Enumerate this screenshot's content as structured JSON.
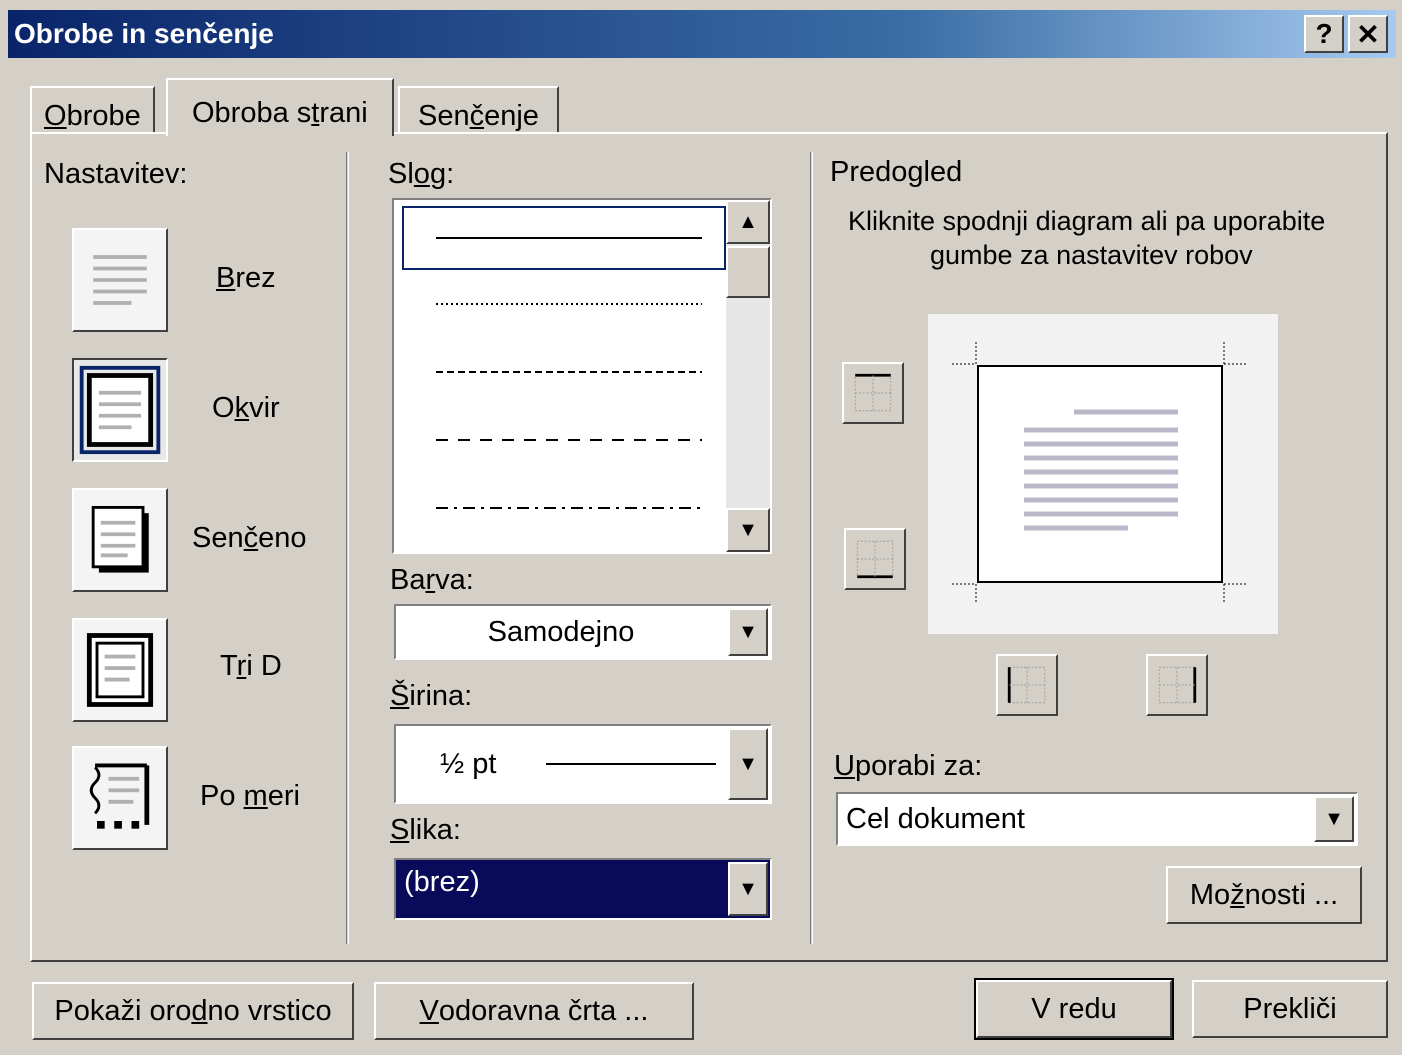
{
  "window": {
    "title": "Obrobe in senčenje",
    "help_label": "?",
    "close_label": "✕"
  },
  "tabs": [
    {
      "label": "Obrobe",
      "accel": "O",
      "rest": "brobe"
    },
    {
      "label": "Obroba strani",
      "pre": "Obroba s",
      "accel": "t",
      "rest": "rani"
    },
    {
      "label": "Senčenje",
      "pre": "Sen",
      "accel": "č",
      "rest": "enje"
    }
  ],
  "settings": {
    "heading": "Nastavitev:",
    "items": [
      {
        "label": "Brez",
        "pre": "",
        "accel": "B",
        "rest": "rez",
        "icon": "none-setting-icon"
      },
      {
        "label": "Okvir",
        "pre": "O",
        "accel": "k",
        "rest": "vir",
        "icon": "box-setting-icon"
      },
      {
        "label": "Senčeno",
        "pre": "Sen",
        "accel": "č",
        "rest": "eno",
        "icon": "shadow-setting-icon"
      },
      {
        "label": "Tri D",
        "pre": "T",
        "accel": "r",
        "rest": "i D",
        "icon": "three-d-setting-icon"
      },
      {
        "label": "Po meri",
        "pre": "Po ",
        "accel": "m",
        "rest": "eri",
        "icon": "custom-setting-icon"
      }
    ]
  },
  "style": {
    "heading": "Slog:",
    "pre": "Sl",
    "accel": "o",
    "rest": "g:",
    "selected_index": 0,
    "items": [
      "solid",
      "dotted",
      "dashed-small",
      "dashed-large",
      "dash-dot"
    ]
  },
  "color": {
    "heading": "Barva:",
    "pre": "Ba",
    "accel": "r",
    "rest": "va:",
    "value": "Samodejno"
  },
  "width": {
    "heading": "Širina:",
    "pre": "",
    "accel": "Š",
    "rest": "irina:",
    "value": "½ pt"
  },
  "art": {
    "heading": "Slika:",
    "pre": "",
    "accel": "S",
    "rest": "lika:",
    "value": "(brez)"
  },
  "preview": {
    "heading": "Predogled",
    "instructions_line1": "Kliknite spodnji diagram ali pa uporabite",
    "instructions_line2": "gumbe za nastavitev robov"
  },
  "apply_to": {
    "heading": "Uporabi za:",
    "pre": "",
    "accel": "U",
    "rest": "porabi za:",
    "value": "Cel dokument"
  },
  "options_button": {
    "label": "Možnosti ...",
    "pre": "Mo",
    "accel": "ž",
    "rest": "nosti ..."
  },
  "footer": {
    "toolbar_button": {
      "label": "Pokaži orodno vrstico",
      "pre": "Pokaži oro",
      "accel": "d",
      "rest": "no vrstico"
    },
    "hline_button": {
      "label": "Vodoravna črta ...",
      "pre": "",
      "accel": "V",
      "rest": "odoravna črta ..."
    },
    "ok_button": "V redu",
    "cancel_button": "Prekliči"
  }
}
